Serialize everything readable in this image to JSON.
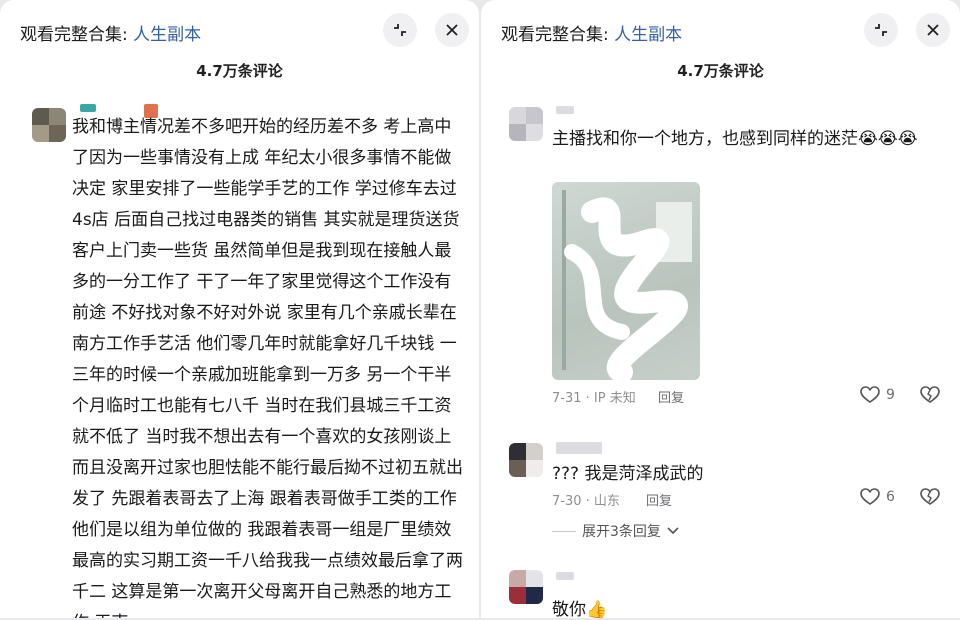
{
  "left": {
    "header": {
      "watch_label": "观看完整合集: ",
      "watch_link": "人生副本"
    },
    "comment_count": "4.7万条评论",
    "comment": {
      "text": "我和博主情况差不多吧开始的经历差不多 考上高中了因为一些事情没有上成 年纪太小很多事情不能做决定 家里安排了一些能学手艺的工作 学过修车去过4s店 后面自己找过电器类的销售 其实就是理货送货客户上门卖一些货 虽然简单但是我到现在接触人最多的一分工作了 干了一年了家里觉得这个工作没有前途 不好找对象不好对外说 家里有几个亲戚长辈在南方工作手艺活 他们零几年时就能拿好几千块钱 一三年的时候一个亲戚加班能拿到一万多 另一个干半个月临时工也能有七八千 当时在我们县城三千工资就不低了 当时我不想出去有一个喜欢的女孩刚谈上 而且没离开过家也胆怯能不能行最后拗不过初五就出发了 先跟着表哥去了上海 跟着表哥做手工类的工作 他们是以组为单位做的 我跟着表哥一组是厂里绩效最高的实习期工资一千八给我我一点绩效最后拿了两千二 这算是第一次离开父母离开自己熟悉的地方工作 天南"
    }
  },
  "right": {
    "header": {
      "watch_label": "观看完整合集: ",
      "watch_link": "人生副本"
    },
    "comment_count": "4.7万条评论",
    "comments": [
      {
        "text": "主播找和你一个地方，也感到同样的迷茫😭😭😭",
        "meta": "7-31 · IP 未知",
        "reply": "回复",
        "likes": "9"
      },
      {
        "text": "??? 我是菏泽成武的",
        "meta": "7-30 · 山东",
        "reply": "回复",
        "likes": "6"
      },
      {
        "text": "敬你👍"
      }
    ],
    "expand_replies": "展开3条回复"
  }
}
